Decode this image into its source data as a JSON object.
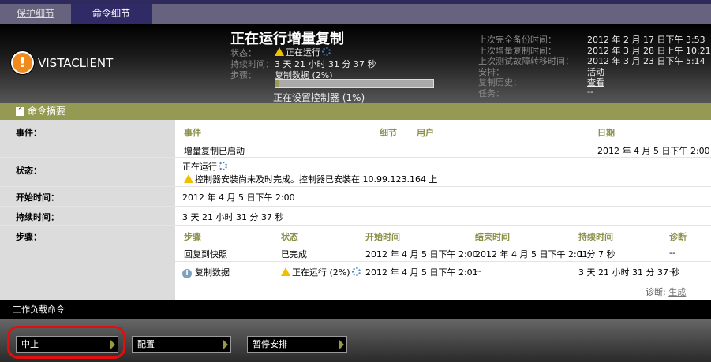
{
  "tabs": [
    "保护细节",
    "命令细节"
  ],
  "header": {
    "client": "VISTACLIENT",
    "title": "正在运行增量复制",
    "status_label": "状态：",
    "status_value": "正在运行",
    "duration_label": "持续时间：",
    "duration_value": "3 天 21 小时 31 分 37 秒",
    "step_label": "步骤：",
    "step_value": "复制数据 (2%)",
    "step_progress_percent": 2,
    "substep": "正在设置控制器 (1%)",
    "right": [
      {
        "label": "上次完全备份时间：",
        "value": "2012 年 2 月 17 日下午 3:53"
      },
      {
        "label": "上次增量复制时间：",
        "value": "2012 年 3 月 28 日上午 10:21"
      },
      {
        "label": "上次测试故障转移时间：",
        "value": "2012 年 3 月 23 日下午 5:14"
      },
      {
        "label": "安排：",
        "value": "活动"
      },
      {
        "label": "复制历史：",
        "value": "查看"
      },
      {
        "label": "任务：",
        "value": "--"
      }
    ]
  },
  "summary": {
    "title": "命令摘要",
    "events_label": "事件：",
    "events_headers": [
      "事件",
      "细节",
      "用户",
      "日期"
    ],
    "event_row": {
      "event": "增量复制已启动",
      "date": "2012 年 4 月 5 日下午 2:00"
    },
    "status_label": "状态：",
    "status_value": "正在运行",
    "status_warning": "控制器安装尚未及时完成。控制器已安装在 10.99.123.164 上",
    "start_label": "开始时间：",
    "start_value": "2012 年 4 月 5 日下午 2:00",
    "duration_label": "持续时间：",
    "duration_value": "3 天 21 小时 31 分 37 秒",
    "steps_label": "步骤：",
    "steps_headers": [
      "步骤",
      "状态",
      "开始时间",
      "结束时间",
      "持续时间",
      "诊断"
    ],
    "steps": [
      {
        "step": "回复到快照",
        "status": "已完成",
        "start": "2012 年 4 月 5 日下午 2:00",
        "end": "2012 年 4 月 5 日下午 2:01",
        "duration": "1 分 7 秒",
        "diag": "--"
      },
      {
        "step": "复制数据",
        "status": "正在运行 (2%)",
        "start": "2012 年 4 月 5 日下午 2:01",
        "end": "--",
        "duration": "3 天 21 小时 31 分 37 秒",
        "diag": "--"
      }
    ],
    "diag_label": "诊断:",
    "diag_link": "生成"
  },
  "workload": {
    "title": "工作负载命令",
    "buttons": [
      "中止",
      "配置",
      "暂停安排"
    ]
  }
}
